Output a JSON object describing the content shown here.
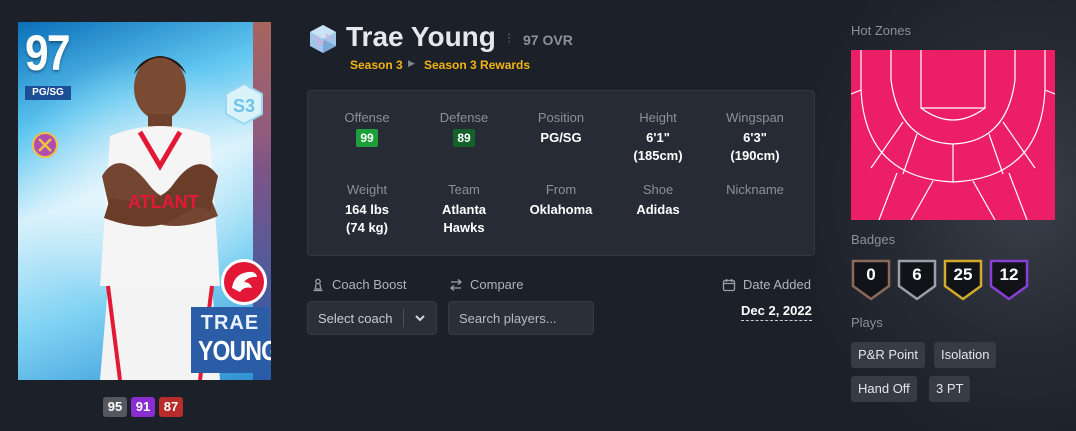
{
  "card": {
    "ovr": "97",
    "position": "PG/SG",
    "first_name": "TRAE",
    "last_name": "YOUNG",
    "colors": {
      "frame": "#5ec6f0",
      "name_box": "#2a5da6",
      "team": "#e31837"
    }
  },
  "ratings": [
    "95",
    "91",
    "87"
  ],
  "header": {
    "name": "Trae Young",
    "separator": "⁝",
    "ovr_text": "97 OVR",
    "breadcrumb": [
      "Season 3",
      "Season 3 Rewards"
    ],
    "accent": "#f3b412"
  },
  "stats": {
    "offense": {
      "label": "Offense",
      "value": "99"
    },
    "defense": {
      "label": "Defense",
      "value": "89"
    },
    "position": {
      "label": "Position",
      "value": "PG/SG"
    },
    "height": {
      "label": "Height",
      "value": "6'1\"",
      "value2": "(185cm)"
    },
    "wingspan": {
      "label": "Wingspan",
      "value": "6'3\"",
      "value2": "(190cm)"
    },
    "weight": {
      "label": "Weight",
      "value": "164 lbs",
      "value2": "(74 kg)"
    },
    "team": {
      "label": "Team",
      "value": "Atlanta",
      "value2": "Hawks"
    },
    "from": {
      "label": "From",
      "value": "Oklahoma"
    },
    "shoe": {
      "label": "Shoe",
      "value": "Adidas"
    },
    "nickname": {
      "label": "Nickname",
      "value": ""
    }
  },
  "controls": {
    "coach_label": "Coach Boost",
    "coach_value": "Select coach",
    "compare_label": "Compare",
    "compare_placeholder": "Search players...",
    "date_label": "Date Added",
    "date_value": "Dec 2, 2022"
  },
  "hot_zones": {
    "label": "Hot Zones",
    "color": "#ec1f66"
  },
  "badges": {
    "label": "Badges",
    "items": [
      {
        "value": "0",
        "color": "#8a6a5a"
      },
      {
        "value": "6",
        "color": "#9aa0a8"
      },
      {
        "value": "25",
        "color": "#d4aa2a"
      },
      {
        "value": "12",
        "color": "#8a3fd6"
      }
    ]
  },
  "plays": {
    "label": "Plays",
    "items": [
      "P&R Point",
      "Isolation",
      "Hand Off",
      "3 PT"
    ]
  }
}
